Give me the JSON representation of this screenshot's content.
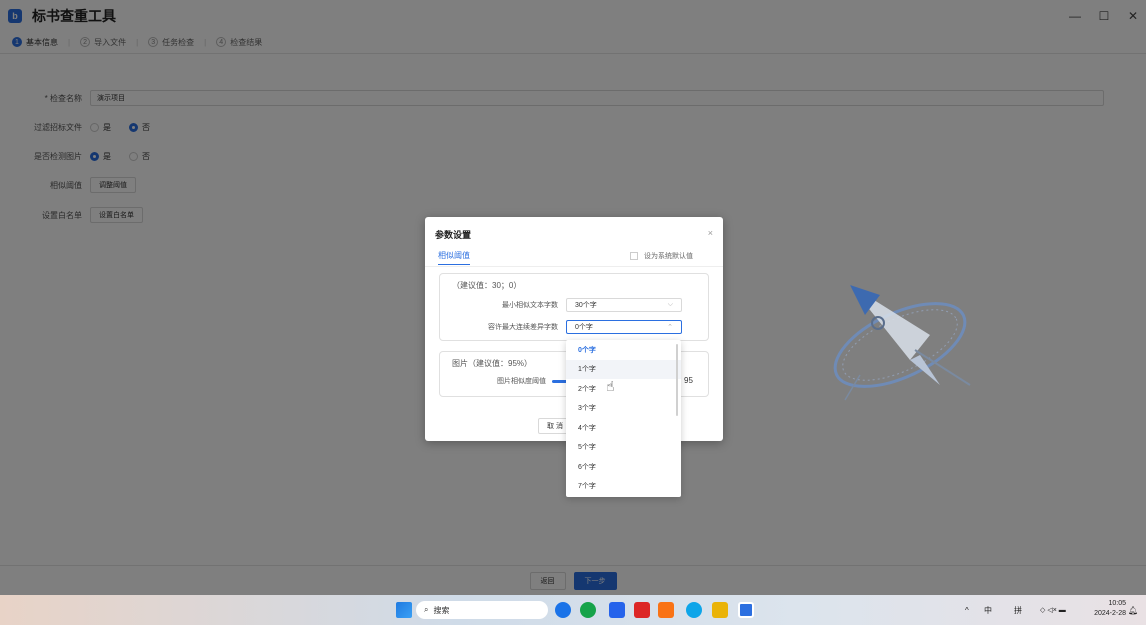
{
  "app": {
    "title": "标书查重工具",
    "logo_letter": "b",
    "window_controls": {
      "minimize": "—",
      "maximize": "☐",
      "close": "✕"
    }
  },
  "steps": [
    {
      "num": "1",
      "label": "基本信息",
      "active": true
    },
    {
      "num": "2",
      "label": "导入文件",
      "active": false
    },
    {
      "num": "3",
      "label": "任务检查",
      "active": false
    },
    {
      "num": "4",
      "label": "检查结果",
      "active": false
    }
  ],
  "form": {
    "check_name": {
      "label": "* 检查名称",
      "value": "演示项目"
    },
    "filter_bid": {
      "label": "过滤招标文件",
      "options": [
        "是",
        "否"
      ],
      "selected": "否"
    },
    "check_images": {
      "label": "是否检测图片",
      "options": [
        "是",
        "否"
      ],
      "selected": "是"
    },
    "threshold": {
      "label": "相似阈值",
      "button": "调整阈值"
    },
    "whitelist": {
      "label": "设置白名单",
      "button": "设置白名单"
    }
  },
  "footer": {
    "back": "返回",
    "next": "下一步"
  },
  "modal": {
    "title": "参数设置",
    "close": "×",
    "tab": "相似阈值",
    "set_default": "设为系统默认值",
    "text_section": {
      "title": "（建议值：30；0）",
      "min_chars_label": "最小相似文本字数",
      "min_chars_value": "30个字",
      "max_diff_label": "容许最大连续差异字数",
      "max_diff_value": "0个字"
    },
    "image_section": {
      "title": "图片（建议值：95%）",
      "similarity_label": "图片相似度阈值",
      "similarity_value": "95",
      "level": 0.95
    },
    "cancel": "取 消"
  },
  "dropdown": {
    "options": [
      "0个字",
      "1个字",
      "2个字",
      "3个字",
      "4个字",
      "5个字",
      "6个字",
      "7个字"
    ],
    "selected_index": 0,
    "hover_index": 1
  },
  "taskbar": {
    "search_placeholder": "搜索",
    "tray": {
      "chevron": "^",
      "ime1": "中",
      "ime2": "拼"
    },
    "time": "10:05",
    "date": "2024-2-28"
  }
}
